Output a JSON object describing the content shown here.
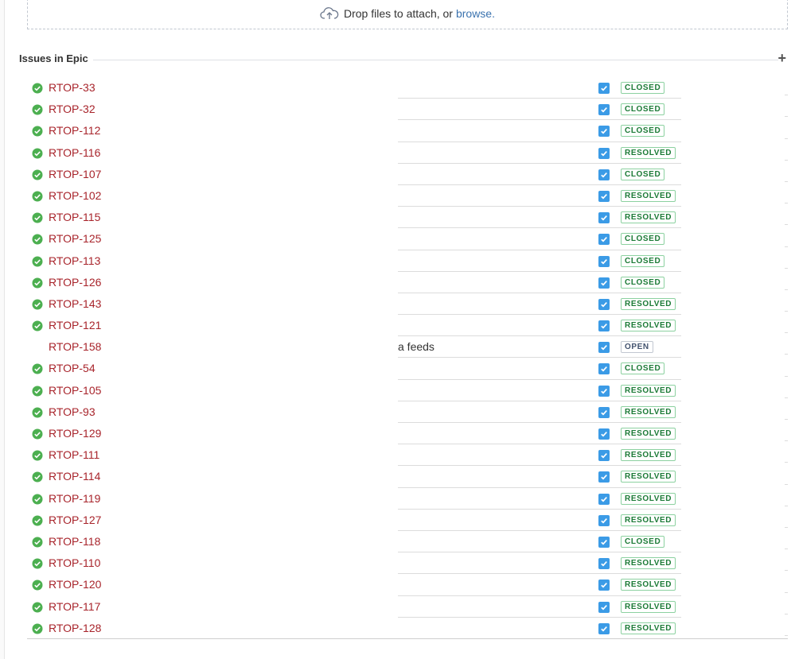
{
  "attachments": {
    "drop_text": "Drop files to attach, or",
    "browse_link": "browse.",
    "icon": "cloud-upload-icon"
  },
  "section": {
    "title": "Issues in Epic",
    "add_icon": "plus-icon"
  },
  "colors": {
    "issue_key": "#a8242b",
    "done_check": "#4caf50",
    "checkbox": "#3b9be6",
    "status_done_border": "#8cd1a0",
    "status_done_text": "#1b7a36",
    "status_open_text": "#42526e"
  },
  "issues": [
    {
      "key": "RTOP-33",
      "done": true,
      "summary": "",
      "status": "CLOSED"
    },
    {
      "key": "RTOP-32",
      "done": true,
      "summary": "",
      "status": "CLOSED"
    },
    {
      "key": "RTOP-112",
      "done": true,
      "summary": "",
      "status": "CLOSED"
    },
    {
      "key": "RTOP-116",
      "done": true,
      "summary": "",
      "status": "RESOLVED"
    },
    {
      "key": "RTOP-107",
      "done": true,
      "summary": "",
      "status": "CLOSED"
    },
    {
      "key": "RTOP-102",
      "done": true,
      "summary": "",
      "status": "RESOLVED"
    },
    {
      "key": "RTOP-115",
      "done": true,
      "summary": "",
      "status": "RESOLVED"
    },
    {
      "key": "RTOP-125",
      "done": true,
      "summary": "",
      "status": "CLOSED"
    },
    {
      "key": "RTOP-113",
      "done": true,
      "summary": "",
      "status": "CLOSED"
    },
    {
      "key": "RTOP-126",
      "done": true,
      "summary": "",
      "status": "CLOSED"
    },
    {
      "key": "RTOP-143",
      "done": true,
      "summary": "",
      "status": "RESOLVED"
    },
    {
      "key": "RTOP-121",
      "done": true,
      "summary": "",
      "status": "RESOLVED"
    },
    {
      "key": "RTOP-158",
      "done": false,
      "summary": "a feeds",
      "status": "OPEN"
    },
    {
      "key": "RTOP-54",
      "done": true,
      "summary": "",
      "status": "CLOSED"
    },
    {
      "key": "RTOP-105",
      "done": true,
      "summary": "",
      "status": "RESOLVED"
    },
    {
      "key": "RTOP-93",
      "done": true,
      "summary": "",
      "status": "RESOLVED"
    },
    {
      "key": "RTOP-129",
      "done": true,
      "summary": "",
      "status": "RESOLVED"
    },
    {
      "key": "RTOP-111",
      "done": true,
      "summary": "",
      "status": "RESOLVED"
    },
    {
      "key": "RTOP-114",
      "done": true,
      "summary": "",
      "status": "RESOLVED"
    },
    {
      "key": "RTOP-119",
      "done": true,
      "summary": "",
      "status": "RESOLVED"
    },
    {
      "key": "RTOP-127",
      "done": true,
      "summary": "",
      "status": "RESOLVED"
    },
    {
      "key": "RTOP-118",
      "done": true,
      "summary": "",
      "status": "CLOSED"
    },
    {
      "key": "RTOP-110",
      "done": true,
      "summary": "",
      "status": "RESOLVED"
    },
    {
      "key": "RTOP-120",
      "done": true,
      "summary": "",
      "status": "RESOLVED"
    },
    {
      "key": "RTOP-117",
      "done": true,
      "summary": "",
      "status": "RESOLVED"
    },
    {
      "key": "RTOP-128",
      "done": true,
      "summary": "",
      "status": "RESOLVED"
    }
  ]
}
